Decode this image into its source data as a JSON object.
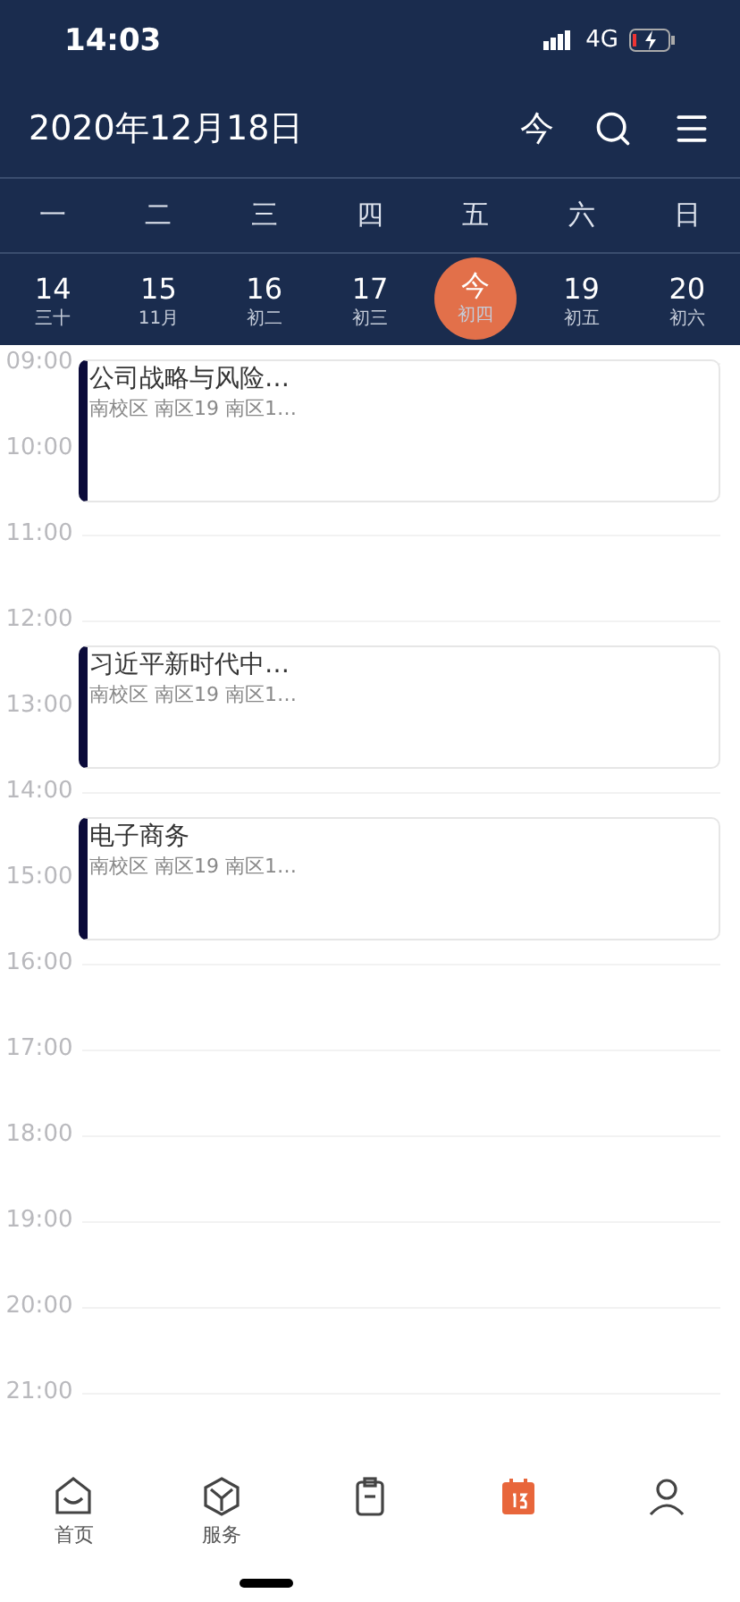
{
  "status_bar": {
    "time": "14:03",
    "network": "4G"
  },
  "header": {
    "title": "2020年12月18日",
    "today_button": "今"
  },
  "weekdays": [
    "一",
    "二",
    "三",
    "四",
    "五",
    "六",
    "日"
  ],
  "days": [
    {
      "day": "14",
      "lunar": "三十",
      "selected": false
    },
    {
      "day": "15",
      "lunar": "11月",
      "selected": false
    },
    {
      "day": "16",
      "lunar": "初二",
      "selected": false
    },
    {
      "day": "17",
      "lunar": "初三",
      "selected": false
    },
    {
      "day": "今",
      "lunar": "初四",
      "selected": true
    },
    {
      "day": "19",
      "lunar": "初五",
      "selected": false
    },
    {
      "day": "20",
      "lunar": "初六",
      "selected": false
    }
  ],
  "hours": [
    {
      "label": "09:00",
      "events": [
        {
          "title": "公司战略与风险…",
          "location": "南校区 南区19 南区1…"
        }
      ]
    },
    {
      "label": "10:00"
    },
    {
      "label": "11:00"
    },
    {
      "label": "12:00",
      "events": [
        {
          "title": "习近平新时代中…",
          "location": "南校区 南区19 南区1…"
        }
      ]
    },
    {
      "label": "13:00"
    },
    {
      "label": "14:00",
      "events": [
        {
          "title": "电子商务",
          "location": "南校区 南区19 南区1…"
        }
      ]
    },
    {
      "label": "15:00"
    },
    {
      "label": "16:00"
    },
    {
      "label": "17:00"
    },
    {
      "label": "18:00"
    },
    {
      "label": "19:00"
    },
    {
      "label": "20:00"
    },
    {
      "label": "21:00"
    }
  ],
  "tab_bar": [
    {
      "kind": "home",
      "label": "首页",
      "selected": false
    },
    {
      "kind": "service",
      "label": "服务",
      "selected": false
    },
    {
      "kind": "clipboard",
      "selected": false
    },
    {
      "kind": "calendar",
      "selected": true
    },
    {
      "kind": "profile",
      "selected": false
    }
  ]
}
